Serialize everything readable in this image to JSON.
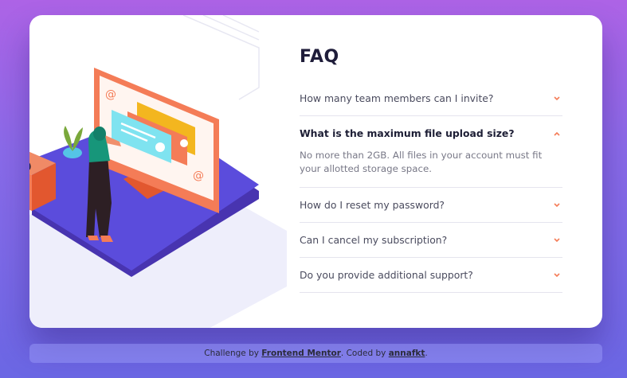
{
  "faq": {
    "title": "FAQ",
    "items": [
      {
        "question": "How many team members can I invite?",
        "answer": "",
        "open": false
      },
      {
        "question": "What is the maximum file upload size?",
        "answer": "No more than 2GB. All files in your account must fit your allotted storage space.",
        "open": true
      },
      {
        "question": "How do I reset my password?",
        "answer": "",
        "open": false
      },
      {
        "question": "Can I cancel my subscription?",
        "answer": "",
        "open": false
      },
      {
        "question": "Do you provide additional support?",
        "answer": "",
        "open": false
      }
    ]
  },
  "illustration": {
    "box_symbol": "@",
    "screen_symbol": "@"
  },
  "footer": {
    "prefix": "Challenge by ",
    "fm_link": "Frontend Mentor",
    "middle": ". Coded by ",
    "author_link": "annafkt",
    "suffix": "."
  },
  "colors": {
    "accent": "#f47c57",
    "heading": "#1f1d3a",
    "text": "#4a4b5e",
    "divider": "#e5e4ee"
  }
}
